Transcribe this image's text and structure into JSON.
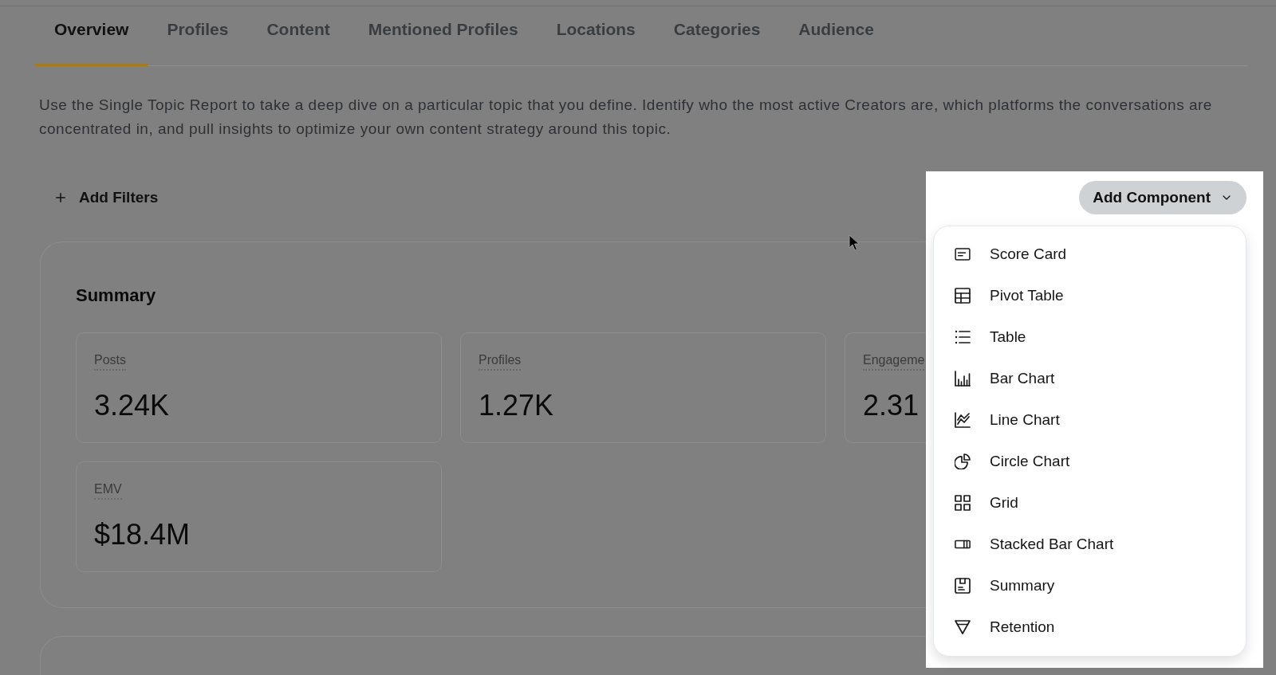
{
  "tabs": [
    {
      "label": "Overview",
      "selected": true
    },
    {
      "label": "Profiles",
      "selected": false
    },
    {
      "label": "Content",
      "selected": false
    },
    {
      "label": "Mentioned Profiles",
      "selected": false
    },
    {
      "label": "Locations",
      "selected": false
    },
    {
      "label": "Categories",
      "selected": false
    },
    {
      "label": "Audience",
      "selected": false
    }
  ],
  "description": "Use the Single Topic Report to take a deep dive on a particular topic that you define. Identify who the most active Creators are, which platforms the conversations are concentrated in, and pull insights to optimize your own content strategy around this topic.",
  "filters_button": {
    "label": "Add Filters"
  },
  "summary": {
    "title": "Summary",
    "stats": [
      {
        "label": "Posts",
        "value": "3.24K"
      },
      {
        "label": "Profiles",
        "value": "1.27K"
      },
      {
        "label": "Engageme",
        "value": "2.31"
      },
      {
        "label": "EMV",
        "value": "$18.4M"
      }
    ]
  },
  "add_component": {
    "label": "Add Component",
    "expanded": true,
    "menu": [
      "Score Card",
      "Pivot Table",
      "Table",
      "Bar Chart",
      "Line Chart",
      "Circle Chart",
      "Grid",
      "Stacked Bar Chart",
      "Summary",
      "Retention"
    ]
  }
}
